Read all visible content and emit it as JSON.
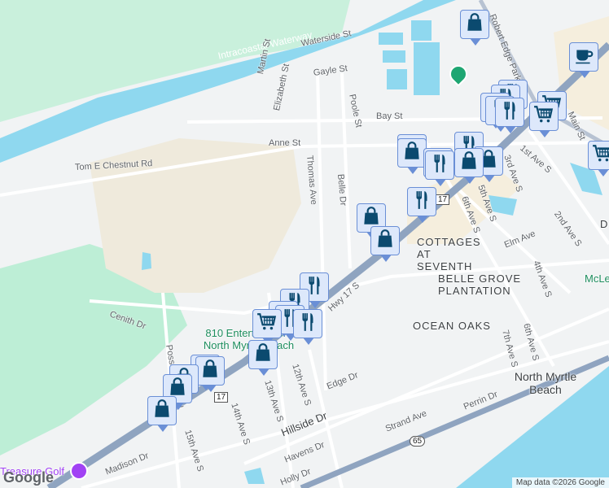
{
  "map": {
    "streets": [
      "Intracoastal Waterway",
      "Waterside St",
      "Gayle St",
      "Martin St",
      "Elizabeth St",
      "Poole St",
      "Bay St",
      "Anne St",
      "Tom E Chestnut Rd",
      "Thomas Ave",
      "Belle Dr",
      "Robert Edge Parkway",
      "1st Ave S",
      "3rd Ave S",
      "5th Ave S",
      "6th Ave S",
      "2nd Ave S",
      "4th Ave S",
      "Elm Ave",
      "Hwy 17 S",
      "Cenith Dr",
      "Possum Trot Rd",
      "12th Ave S",
      "13th Ave S",
      "14th Ave S",
      "15th Ave S",
      "Edge Dr",
      "Hillside Dr",
      "Strand Ave",
      "Perrin Dr",
      "Havens Dr",
      "Holly Dr",
      "Madison Dr",
      "7th Ave S",
      "6th Ave S",
      "Main St",
      "D",
      "McLe"
    ],
    "areas": [
      "COTTAGES AT SEVENTH",
      "BELLE GROVE PLANTATION",
      "OCEAN OAKS",
      "North Myrtle Beach"
    ],
    "pois": [
      "810 Entertainment North Myrtle Beach",
      "Treasure Golf"
    ],
    "shields": [
      "17",
      "17",
      "65"
    ],
    "attribution": "Map data ©2026 Google",
    "logo": "Google",
    "colors": {
      "marker_fill": "#dde8fb",
      "marker_border": "#6a8fd6",
      "icon": "#0b4a6f",
      "water": "#8fd8ef",
      "park": "#bdeed6",
      "highway": "#8fa4c0"
    }
  }
}
